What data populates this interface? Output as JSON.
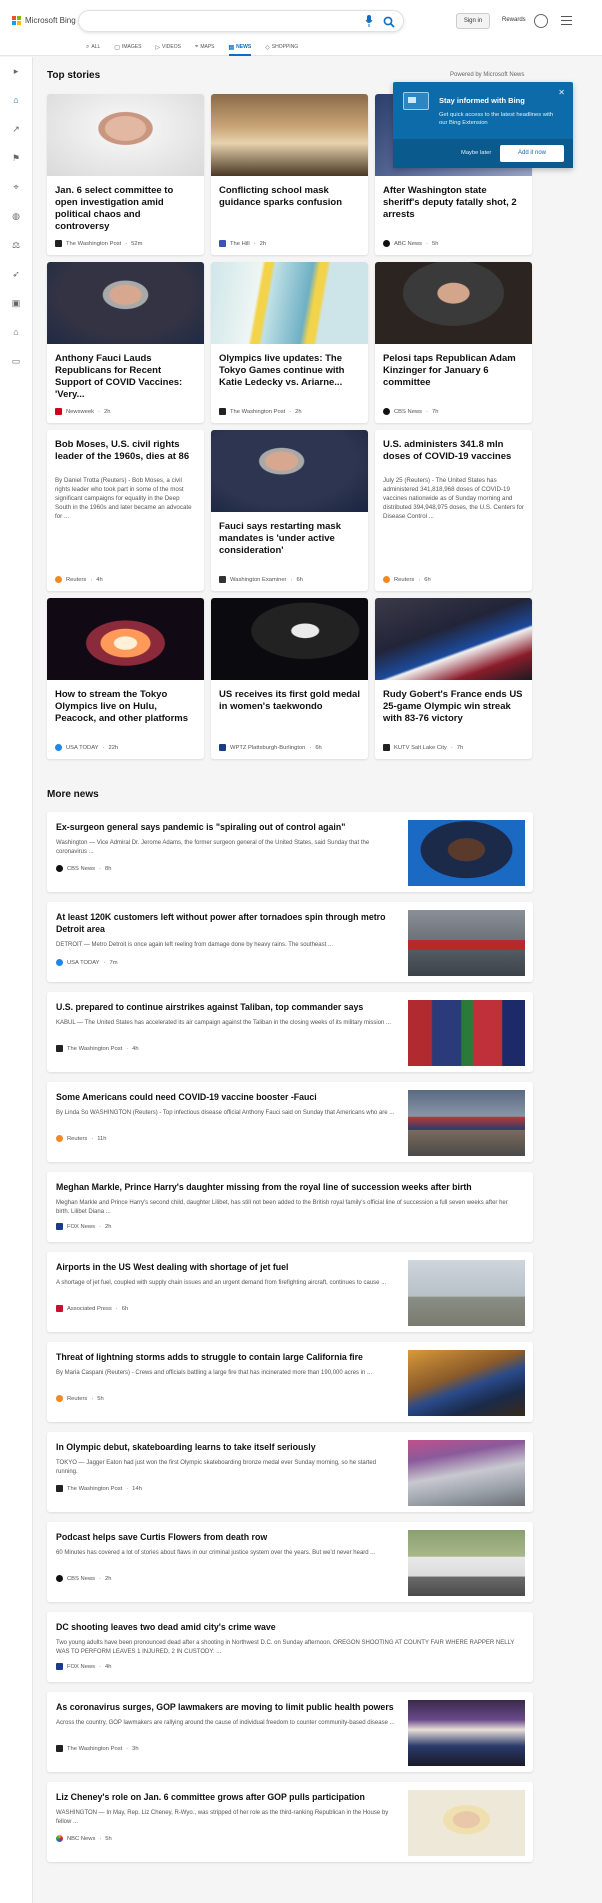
{
  "header": {
    "logo_text": "Microsoft Bing",
    "signin": "Sign in",
    "rewards": "Rewards"
  },
  "tabs": [
    {
      "label": "ALL",
      "icon": "search-icon"
    },
    {
      "label": "IMAGES",
      "icon": "image-icon"
    },
    {
      "label": "VIDEOS",
      "icon": "video-icon"
    },
    {
      "label": "MAPS",
      "icon": "map-pin-icon"
    },
    {
      "label": "NEWS",
      "icon": "news-icon",
      "active": true
    },
    {
      "label": "SHOPPING",
      "icon": "tag-icon"
    }
  ],
  "top_stories": {
    "title": "Top stories",
    "powered": "Powered by Microsoft News"
  },
  "popup": {
    "title": "Stay informed with Bing",
    "description": "Get quick access to the latest headlines with our Bing Extension",
    "maybe_later": "Maybe later",
    "add_button": "Add it now"
  },
  "cards": [
    {
      "title": "Jan. 6 select committee to open investigation amid political chaos and controversy",
      "source": "The Washington Post",
      "time": "52m"
    },
    {
      "title": "Conflicting school mask guidance sparks confusion",
      "source": "The Hill",
      "time": "2h"
    },
    {
      "title": "After Washington state sheriff's deputy fatally shot, 2 arrests",
      "source": "ABC News",
      "time": "5h"
    },
    {
      "title": "Anthony Fauci Lauds Republicans for Recent Support of COVID Vaccines: 'Very...",
      "source": "Newsweek",
      "time": "2h"
    },
    {
      "title": "Olympics live updates: The Tokyo Games continue with Katie Ledecky vs. Ariarne...",
      "source": "The Washington Post",
      "time": "2h"
    },
    {
      "title": "Pelosi taps Republican Adam Kinzinger for January 6 committee",
      "source": "CBS News",
      "time": "7h"
    },
    {
      "title": "Bob Moses, U.S. civil rights leader of the 1960s, dies at 86",
      "snippet": "By Daniel Trotta (Reuters) - Bob Moses, a civil rights leader who took part in some of the most significant campaigns for equality in the Deep South in the 1960s and later became an advocate for ...",
      "source": "Reuters",
      "time": "4h"
    },
    {
      "title": "Fauci says restarting mask mandates is 'under active consideration'",
      "source": "Washington Examiner",
      "time": "6h"
    },
    {
      "title": "U.S. administers 341.8 mln doses of COVID-19 vaccines",
      "snippet": "July 25 (Reuters) - The United States has administered 341,818,968 doses of COVID-19 vaccines nationwide as of Sunday morning and distributed 394,948,975 doses, the U.S. Centers for Disease Control ...",
      "source": "Reuters",
      "time": "6h"
    },
    {
      "title": "How to stream the Tokyo Olympics live on Hulu, Peacock, and other platforms",
      "source": "USA TODAY",
      "time": "22h"
    },
    {
      "title": "US receives its first gold medal in women's taekwondo",
      "source": "WPTZ Plattsburgh-Burlington",
      "time": "6h"
    },
    {
      "title": "Rudy Gobert's France ends US 25-game Olympic win streak with 83-76 victory",
      "source": "KUTV Salt Lake City",
      "time": "7h"
    }
  ],
  "more_news": {
    "title": "More news",
    "items": [
      {
        "title": "Ex-surgeon general says pandemic is \"spiraling out of control again\"",
        "snippet": "Washington — Vice Admiral Dr. Jerome Adams, the former surgeon general of the United States, said Sunday that the coronavirus ...",
        "source": "CBS News",
        "time": "8h"
      },
      {
        "title": "At least 120K customers left without power after tornadoes spin through metro Detroit area",
        "snippet": "DETROIT — Metro Detroit is once again left reeling from damage done by heavy rains. The southeast ...",
        "source": "USA TODAY",
        "time": "7m"
      },
      {
        "title": "U.S. prepared to continue airstrikes against Taliban, top commander says",
        "snippet": "KABUL — The United States has accelerated its air campaign against the Taliban in the closing weeks of its military mission ...",
        "source": "The Washington Post",
        "time": "4h"
      },
      {
        "title": "Some Americans could need COVID-19 vaccine booster -Fauci",
        "snippet": "By Linda So WASHINGTON (Reuters) - Top infectious disease official Anthony Fauci said on Sunday that Americans who are ...",
        "source": "Reuters",
        "time": "11h"
      },
      {
        "title": "Meghan Markle, Prince Harry's daughter missing from the royal line of succession weeks after birth",
        "snippet": "Meghan Markle and Prince Harry's second child, daughter Lilibet, has still not been added to the British royal family's official line of succession a full seven weeks after her birth. Lilibet Diana ...",
        "source": "FOX News",
        "time": "2h"
      },
      {
        "title": "Airports in the US West dealing with shortage of jet fuel",
        "snippet": "A shortage of jet fuel, coupled with supply chain issues and an urgent demand from firefighting aircraft, continues to cause ...",
        "source": "Associated Press",
        "time": "6h"
      },
      {
        "title": "Threat of lightning storms adds to struggle to contain large California fire",
        "snippet": "By Maria Caspani (Reuters) - Crews and officials battling a large fire that has incinerated more than 190,000 acres in ...",
        "source": "Reuters",
        "time": "5h"
      },
      {
        "title": "In Olympic debut, skateboarding learns to take itself seriously",
        "snippet": "TOKYO — Jagger Eaton had just won the first Olympic skateboarding bronze medal ever Sunday morning, so he started running.",
        "source": "The Washington Post",
        "time": "14h"
      },
      {
        "title": "Podcast helps save Curtis Flowers from death row",
        "snippet": "60 Minutes has covered a lot of stories about flaws in our criminal justice system over the years.  But we'd never heard ...",
        "source": "CBS News",
        "time": "2h"
      },
      {
        "title": "DC shooting leaves two dead amid city's crime wave",
        "snippet": "Two young adults have been pronounced dead after a shooting in Northwest D.C. on Sunday afternoon. OREGON SHOOTING AT COUNTY FAIR WHERE RAPPER NELLY WAS TO PERFORM LEAVES 1 INJURED, 2 IN CUSTODY: ...",
        "source": "FOX News",
        "time": "4h"
      },
      {
        "title": "As coronavirus surges, GOP lawmakers are moving to limit public health powers",
        "snippet": "Across the country, GOP lawmakers are rallying around the cause of individual freedom to counter community-based disease ...",
        "source": "The Washington Post",
        "time": "3h"
      },
      {
        "title": "Liz Cheney's role on Jan. 6 committee grows after GOP pulls participation",
        "snippet": "WASHINGTON — In May, Rep. Liz Cheney, R-Wyo., was stripped of her role as the third-ranking Republican in the House by fellow ...",
        "source": "NBC News",
        "time": "5h"
      }
    ]
  },
  "colors": {
    "accent": "#0b6ec4",
    "popup": "#0c6ba8"
  }
}
